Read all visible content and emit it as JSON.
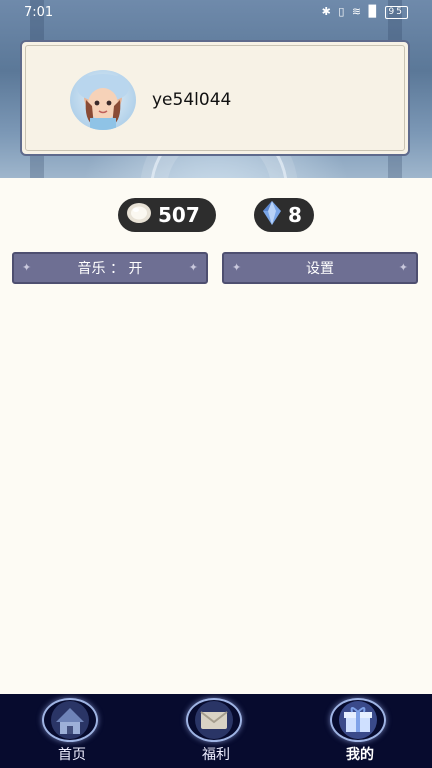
{
  "status_bar": {
    "time": "7:01",
    "icons": "✱ ▯ ≋ ▉",
    "battery": "95"
  },
  "profile": {
    "username": "ye54l044"
  },
  "currency": {
    "coins": "507",
    "gems": "8"
  },
  "controls": {
    "music_label": "音乐 ： 开",
    "settings_label": "设置"
  },
  "nav": {
    "items": [
      {
        "label": "首页",
        "icon": "house-icon",
        "active": false
      },
      {
        "label": "福利",
        "icon": "gift-envelope-icon",
        "active": false
      },
      {
        "label": "我的",
        "icon": "gift-box-icon",
        "active": true
      }
    ]
  },
  "colors": {
    "background": "#fdfbf4",
    "button": "#6e6f93",
    "nav_bar": "#070b2e",
    "currency_pill": "#2d2d2d"
  }
}
